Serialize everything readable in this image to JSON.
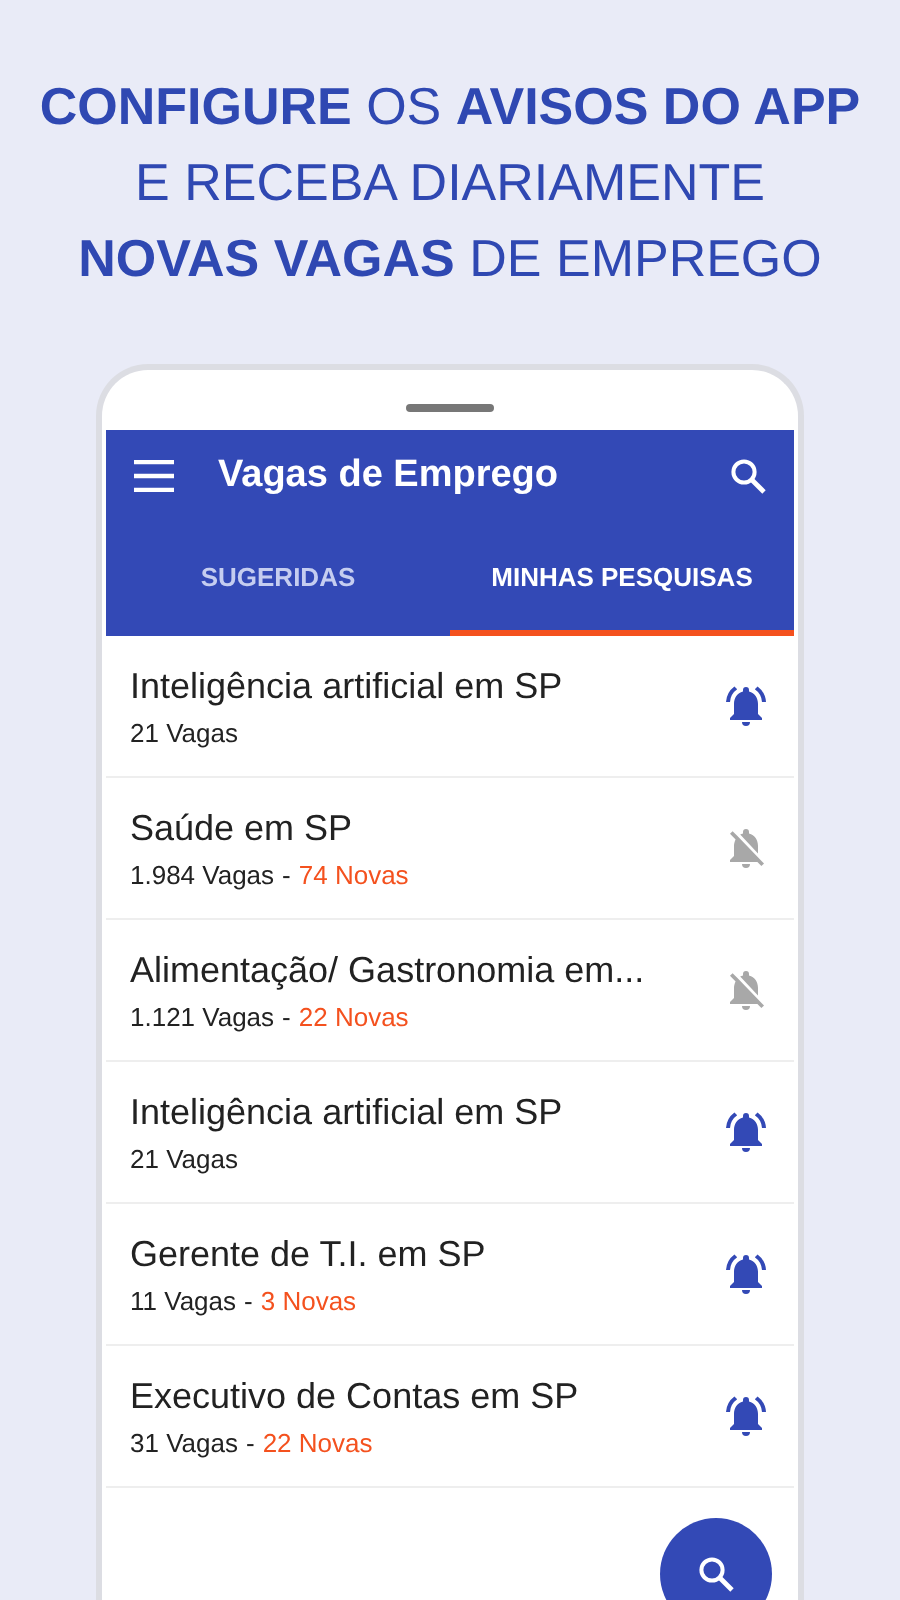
{
  "headline": [
    "**CONFIGURE** OS **AVISOS DO APP**",
    "E RECEBA DIARIAMENTE",
    "**NOVAS VAGAS** DE EMPREGO"
  ],
  "app_bar": {
    "title": "Vagas de Emprego"
  },
  "tabs": [
    {
      "label": "SUGERIDAS",
      "selected": false
    },
    {
      "label": "MINHAS PESQUISAS",
      "selected": true
    }
  ],
  "searches": [
    {
      "title": "Inteligência artificial em SP",
      "count": "21 Vagas",
      "alerts_on": true
    },
    {
      "title": "Saúde em SP",
      "count": "1.984 Vagas",
      "separator": "-",
      "new": "74 Novas",
      "alerts_on": false
    },
    {
      "title": "Alimentação/ Gastronomia em...",
      "count": "1.121 Vagas",
      "separator": "-",
      "new": "22 Novas",
      "alerts_on": false
    },
    {
      "title": "Inteligência artificial em SP",
      "count": "21 Vagas",
      "alerts_on": true
    },
    {
      "title": "Gerente de T.I. em SP",
      "count": "11 Vagas",
      "separator": "-",
      "new": "3 Novas",
      "alerts_on": true
    },
    {
      "title": "Executivo de Contas em SP",
      "count": "31 Vagas",
      "separator": "-",
      "new": "22 Novas",
      "alerts_on": true
    }
  ]
}
